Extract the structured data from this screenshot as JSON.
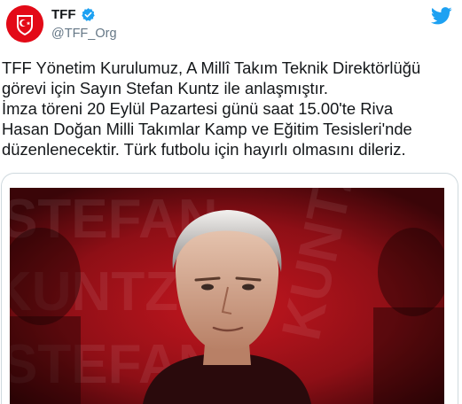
{
  "account": {
    "display_name": "TFF",
    "handle": "@TFF_Org",
    "verified": true,
    "avatar": "tff-crest-logo"
  },
  "brand_icon": "twitter-bird-icon",
  "tweet": {
    "lines": [
      "TFF Yönetim Kurulumuz, A Millî Takım Teknik Direktörlüğü",
      "görevi için Sayın Stefan Kuntz ile anlaşmıştır.",
      "İmza töreni 20 Eylül Pazartesi günü saat 15.00'te Riva",
      "Hasan Doğan Milli Takımlar Kamp ve Eğitim Tesisleri'nde",
      "düzenlenecektir. Türk futbolu için hayırlı olmasını dileriz."
    ]
  },
  "media": {
    "background_text": [
      "STEFAN",
      "KUNTZ"
    ],
    "colors": {
      "red_dark": "#5a0a0e",
      "red": "#b5121b",
      "twitter_blue": "#1da1f2"
    }
  }
}
